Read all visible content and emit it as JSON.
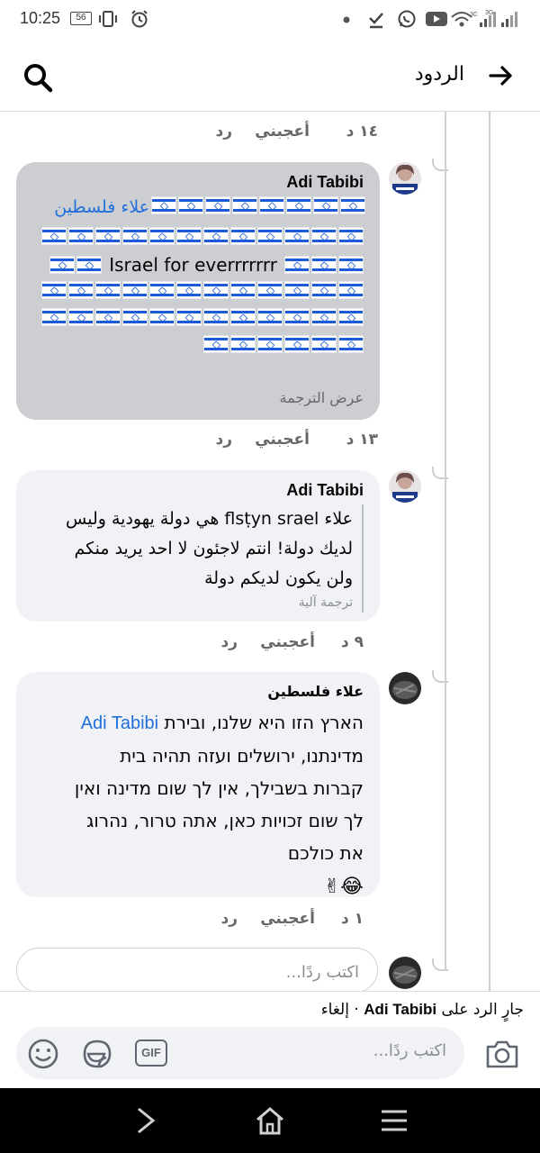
{
  "status_bar": {
    "time": "10:25",
    "badge": "56"
  },
  "header": {
    "title": "الردود"
  },
  "comments": [
    {
      "meta": {
        "time": "١٤ د",
        "like": "أعجبني",
        "reply": "رد"
      }
    },
    {
      "author": "Adi Tabibi",
      "mention": "علاء فلسطين",
      "text_middle": "Israel for everrrrrrr",
      "translate": "عرض الترجمة",
      "meta": {
        "time": "١٣ د",
        "like": "أعجبني",
        "reply": "رد"
      }
    },
    {
      "author": "Adi Tabibi",
      "lines": [
        "علاء flsṭyn srael هي دولة يهودية وليس",
        "لديك دولة! انتم لاجئون لا احد يريد منكم",
        "ولن يكون لديكم دولة"
      ],
      "translation_label": "ترجمة آلية",
      "meta": {
        "time": "٩ د",
        "like": "أعجبني",
        "reply": "رد"
      }
    },
    {
      "author": "علاء فلسطين",
      "mention": "Adi Tabibi",
      "line1_rest": "הארץ הזו היא שלנו, ובירת",
      "lines": [
        "מדינתנו, ירושלים ועזה תהיה בית",
        "קברות בשבילך, אין לך שום מדינה ואין",
        "לך שום זכויות כאן, אתה טרור, נהרוג",
        "את כולכם"
      ],
      "emoji": "😂✌",
      "meta": {
        "time": "١ د",
        "like": "أعجبني",
        "reply": "رد"
      }
    }
  ],
  "reply_box": {
    "placeholder": "اكتب ردًا..."
  },
  "replying_bar": {
    "prefix": "جارٍ الرد على",
    "name": "Adi Tabibi",
    "cancel": "· إلغاء"
  },
  "composer": {
    "placeholder": "اكتب ردًا...",
    "gif_label": "GIF"
  }
}
